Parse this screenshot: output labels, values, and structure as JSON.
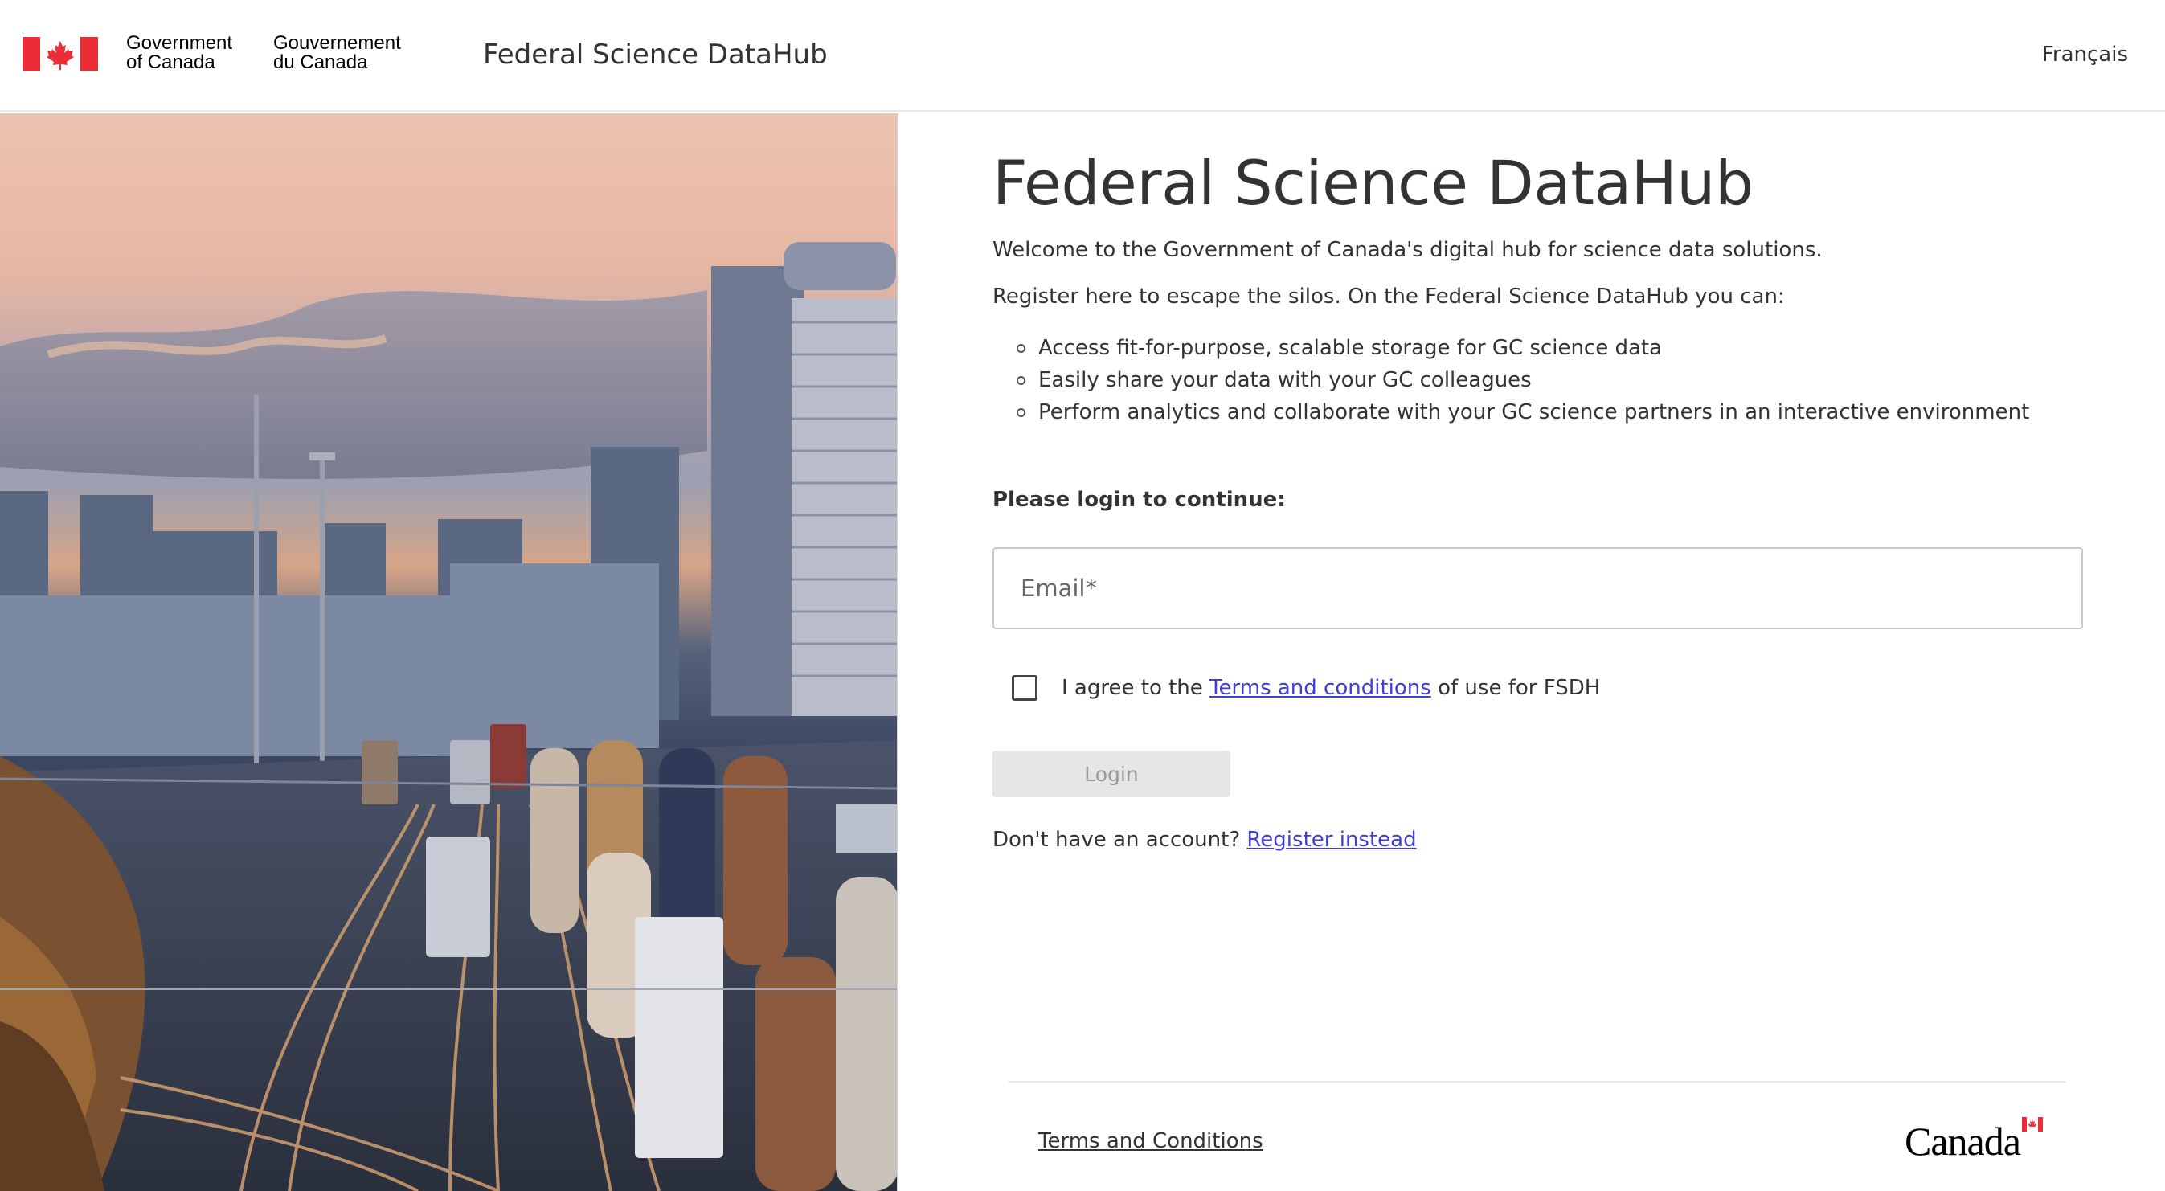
{
  "header": {
    "signature_en_line1": "Government",
    "signature_en_line2": "of Canada",
    "signature_fr_line1": "Gouvernement",
    "signature_fr_line2": "du Canada",
    "app_title": "Federal Science DataHub",
    "language_toggle": "Français"
  },
  "main": {
    "heading": "Federal Science DataHub",
    "welcome": "Welcome to the Government of Canada's digital hub for science data solutions.",
    "register_intro": "Register here to escape the silos. On the Federal Science DataHub you can:",
    "bullets": [
      "Access fit-for-purpose, scalable storage for GC science data",
      "Easily share your data with your GC colleagues",
      "Perform analytics and collaborate with your GC science partners in an interactive environment"
    ],
    "login_heading": "Please login to continue:",
    "email_placeholder": "Email*",
    "agree_prefix": "I agree to the",
    "agree_link": "Terms and conditions",
    "agree_suffix": "of use for FSDH",
    "login_button": "Login",
    "no_account_text": "Don't have an account?",
    "register_link": "Register instead"
  },
  "footer": {
    "terms_link": "Terms and Conditions",
    "wordmark": "Canada"
  },
  "colors": {
    "flag_red": "#eb2d37",
    "link": "#3f3fd0",
    "disabled_button_bg": "#e6e6e6",
    "text": "#333333"
  }
}
